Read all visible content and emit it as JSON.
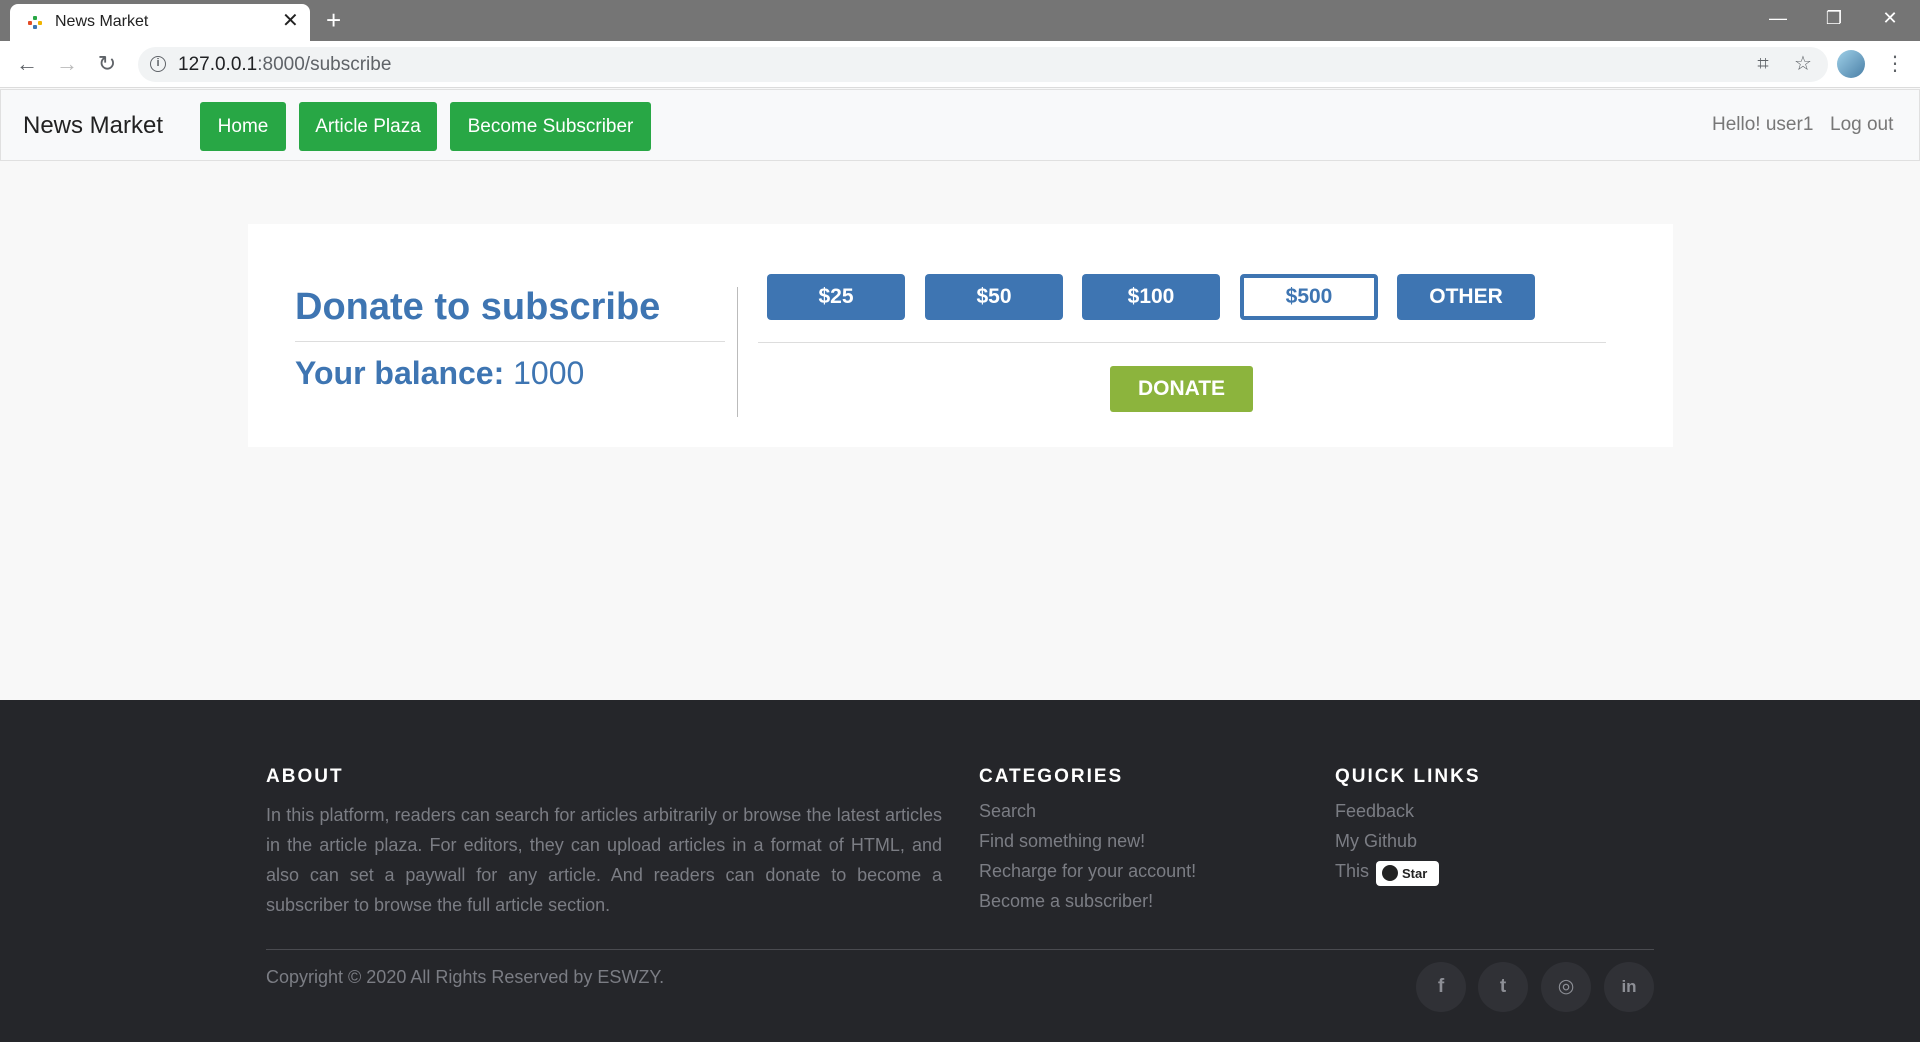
{
  "browser": {
    "tab_title": "News Market",
    "close_glyph": "✕",
    "new_tab_glyph": "+",
    "url_host": "127.0.0.1",
    "url_path": ":8000/subscribe",
    "back_glyph": "←",
    "forward_glyph": "→",
    "reload_glyph": "↻",
    "info_glyph": "i",
    "translate_glyph": "⌗",
    "star_glyph": "☆",
    "menu_glyph": "⋮",
    "minimize_glyph": "—",
    "restore_glyph": "❐",
    "window_close_glyph": "✕"
  },
  "navbar": {
    "brand": "News Market",
    "items": [
      "Home",
      "Article Plaza",
      "Become Subscriber"
    ],
    "greeting": "Hello! user1",
    "logout": "Log out",
    "button_color": "#28a745"
  },
  "donate_card": {
    "title": "Donate to subscribe",
    "balance_label": "Your balance:",
    "balance_value": "1000",
    "amounts": [
      "$25",
      "$50",
      "$100",
      "$500",
      "OTHER"
    ],
    "selected_amount": "$500",
    "donate_label": "DONATE",
    "accent_color": "#3e75b2",
    "donate_color": "#8cb43d"
  },
  "footer": {
    "about_heading": "ABOUT",
    "about_text": "In this platform, readers can search for articles arbitrarily or browse the latest articles in the article plaza. For editors, they can upload articles in a format of HTML, and also can set a paywall for any article. And readers can donate to become a subscriber to browse the full article section.",
    "categories_heading": "CATEGORIES",
    "categories": [
      "Search",
      "Find something new!",
      "Recharge for your account!",
      "Become a subscriber!"
    ],
    "quicklinks_heading": "QUICK LINKS",
    "quicklinks": [
      "Feedback",
      "My Github",
      "This"
    ],
    "star_label": "Star",
    "copyright": "Copyright © 2020 All Rights Reserved by ESWZY.",
    "social": [
      {
        "icon": "facebook-icon",
        "glyph": "f"
      },
      {
        "icon": "twitter-icon",
        "glyph": "t"
      },
      {
        "icon": "dribbble-icon",
        "glyph": "◎"
      },
      {
        "icon": "linkedin-icon",
        "glyph": "in"
      }
    ]
  }
}
